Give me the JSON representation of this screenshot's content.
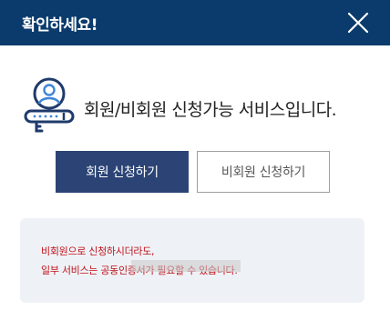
{
  "dialog": {
    "title": "확인하세요!",
    "close_icon": "close-icon"
  },
  "info": {
    "icon": "person-id-card-icon",
    "text": "회원/비회원 신청가능 서비스입니다."
  },
  "buttons": {
    "member": "회원 신청하기",
    "non_member": "비회원 신청하기"
  },
  "notice": {
    "line1": "비회원으로 신청하시더라도,",
    "line2": "일부 서비스는 공동인증서가 필요할 수 있습니다."
  },
  "colors": {
    "header_bg": "#0b3b6c",
    "primary_button": "#2b4475",
    "notice_bg": "#eef2f6",
    "notice_text": "#c2111a",
    "icon_navy": "#1f3a6b",
    "icon_blue": "#3d86d8"
  }
}
